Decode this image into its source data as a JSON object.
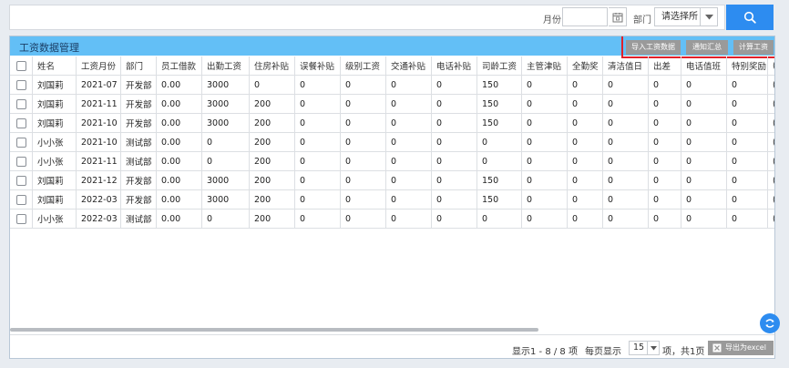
{
  "filters": {
    "month_label": "月份",
    "month_value": "",
    "dept_label": "部门",
    "dept_selected": "请选择所"
  },
  "panel": {
    "title": "工资数据管理",
    "actions": [
      "导入工资数据",
      "通知汇总",
      "计算工资"
    ]
  },
  "table": {
    "columns": [
      "姓名",
      "工资月份",
      "部门",
      "员工借款",
      "出勤工资",
      "住房补贴",
      "误餐补贴",
      "级别工资",
      "交通补贴",
      "电话补贴",
      "司龄工资",
      "主管津贴",
      "全勤奖",
      "清洁值日",
      "出差",
      "电话值班",
      "特别奖励",
      "("
    ],
    "rows": [
      [
        "刘国莉",
        "2021-07",
        "开发部",
        "0.00",
        "3000",
        "0",
        "0",
        "0",
        "0",
        "0",
        "150",
        "0",
        "0",
        "0",
        "0",
        "0",
        "0",
        "("
      ],
      [
        "刘国莉",
        "2021-11",
        "开发部",
        "0.00",
        "3000",
        "200",
        "0",
        "0",
        "0",
        "0",
        "150",
        "0",
        "0",
        "0",
        "0",
        "0",
        "0",
        "("
      ],
      [
        "刘国莉",
        "2021-10",
        "开发部",
        "0.00",
        "3000",
        "200",
        "0",
        "0",
        "0",
        "0",
        "150",
        "0",
        "0",
        "0",
        "0",
        "0",
        "0",
        "("
      ],
      [
        "小小张",
        "2021-10",
        "测试部",
        "0.00",
        "0",
        "200",
        "0",
        "0",
        "0",
        "0",
        "0",
        "0",
        "0",
        "0",
        "0",
        "0",
        "0",
        "("
      ],
      [
        "小小张",
        "2021-11",
        "测试部",
        "0.00",
        "0",
        "200",
        "0",
        "0",
        "0",
        "0",
        "0",
        "0",
        "0",
        "0",
        "0",
        "0",
        "0",
        "("
      ],
      [
        "刘国莉",
        "2021-12",
        "开发部",
        "0.00",
        "3000",
        "200",
        "0",
        "0",
        "0",
        "0",
        "150",
        "0",
        "0",
        "0",
        "0",
        "0",
        "0",
        "("
      ],
      [
        "刘国莉",
        "2022-03",
        "开发部",
        "0.00",
        "3000",
        "200",
        "0",
        "0",
        "0",
        "0",
        "150",
        "0",
        "0",
        "0",
        "0",
        "0",
        "0",
        "("
      ],
      [
        "小小张",
        "2022-03",
        "测试部",
        "0.00",
        "0",
        "200",
        "0",
        "0",
        "0",
        "0",
        "0",
        "0",
        "0",
        "0",
        "0",
        "0",
        "0",
        "("
      ]
    ]
  },
  "pager": {
    "summary": "显示1 - 8 / 8 项",
    "per_page_label": "每页显示",
    "page_size": "15",
    "suffix": "项，共1页",
    "export_label": "导出为excel"
  },
  "icons": {
    "search": "search-icon",
    "calendar": "calendar-icon",
    "dropdown": "chevron-down-icon",
    "export": "excel-icon",
    "fab": "sync-icon"
  },
  "colors": {
    "accent": "#2d8cf0",
    "header": "#63bff6",
    "action_button": "#9a9a9a",
    "highlight": "#e0202a"
  }
}
